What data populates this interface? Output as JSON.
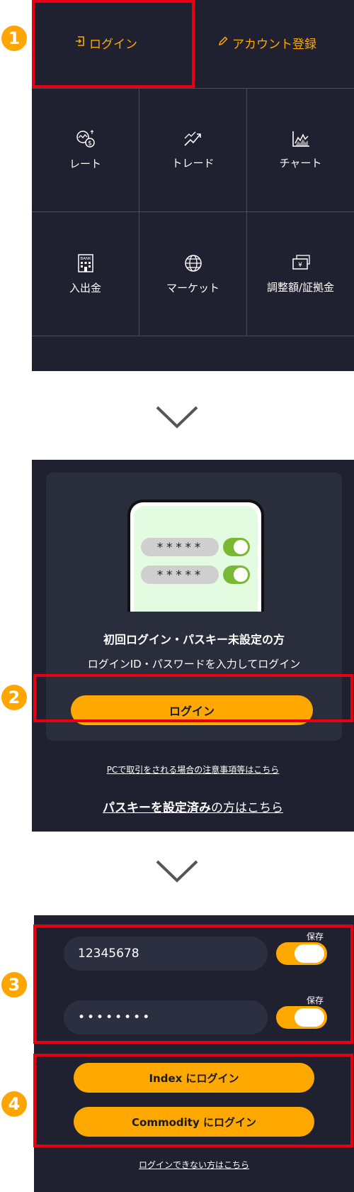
{
  "steps": [
    "1",
    "2",
    "3",
    "4"
  ],
  "menu": {
    "login_label": "ログイン",
    "register_label": "アカウント登録",
    "items": [
      {
        "label": "レート",
        "icon": "rate-currency-icon"
      },
      {
        "label": "トレード",
        "icon": "trade-arrows-icon"
      },
      {
        "label": "チャート",
        "icon": "chart-icon"
      },
      {
        "label": "入出金",
        "icon": "bank-icon"
      },
      {
        "label": "マーケット",
        "icon": "globe-icon"
      },
      {
        "label": "調整額/証拠金",
        "icon": "yen-bill-icon"
      }
    ]
  },
  "login_card": {
    "password_mask_1": "*****",
    "password_mask_2": "*****",
    "title": "初回ログイン・パスキー未設定の方",
    "subtitle": "ログインID・パスワードを入力してログイン",
    "button_label": "ログイン",
    "pc_note_link": "PCで取引をされる場合の注意事項等はこちら",
    "passkey_link_bold": "パスキーを設定済み",
    "passkey_link_rest": "の方はこちら"
  },
  "login_form": {
    "id_value": "12345678",
    "password_value": "••••••••",
    "save_label_1": "保存",
    "save_label_2": "保存",
    "index_button": "Index にログイン",
    "commodity_button": "Commodity にログイン",
    "cannot_login_link": "ログインできない方はこちら"
  },
  "colors": {
    "accent": "#ffa800",
    "panel_bg": "#1f2130",
    "highlight": "#e60012",
    "step_badge": "#ffa500"
  }
}
